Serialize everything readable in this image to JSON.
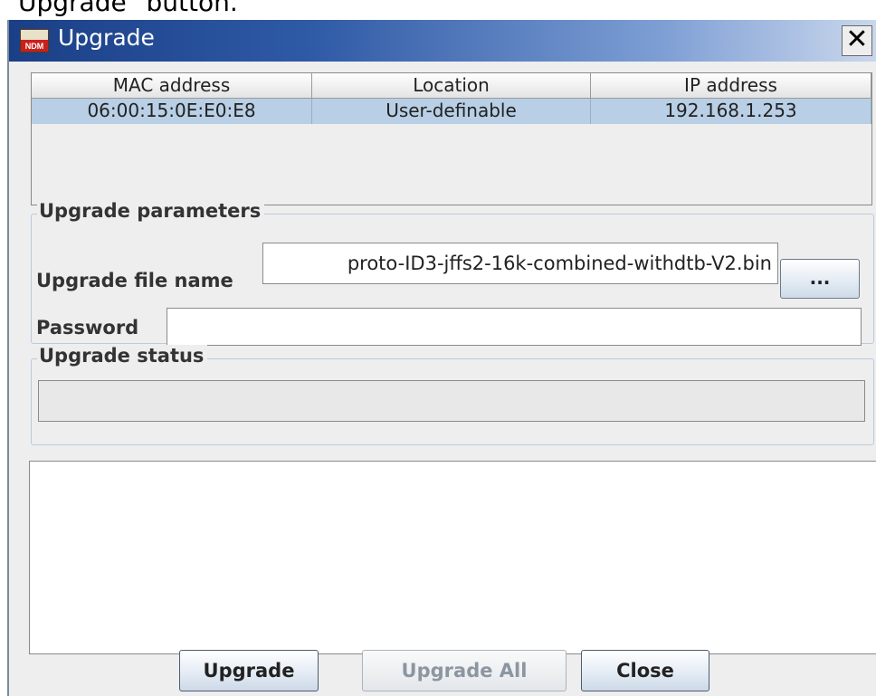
{
  "caption": "Upgrade\" button.",
  "window": {
    "title": "Upgrade",
    "icon": "ndm-app-icon",
    "icon_text": "NDM",
    "close_glyph": "✕"
  },
  "device_table": {
    "columns": [
      "MAC address",
      "Location",
      "IP address"
    ],
    "rows": [
      [
        "06:00:15:0E:E0:E8",
        "User-definable",
        "192.168.1.253"
      ]
    ]
  },
  "upgrade_parameters": {
    "legend": "Upgrade parameters",
    "file_label": "Upgrade file name",
    "file_value": "proto-ID3-jffs2-16k-combined-withdtb-V2.bin",
    "browse_label": "...",
    "password_label": "Password",
    "password_value": ""
  },
  "upgrade_status": {
    "legend": "Upgrade status",
    "progress": 0
  },
  "log": {
    "text": ""
  },
  "buttons": {
    "upgrade": "Upgrade",
    "upgrade_all": "Upgrade All",
    "close": "Close"
  }
}
